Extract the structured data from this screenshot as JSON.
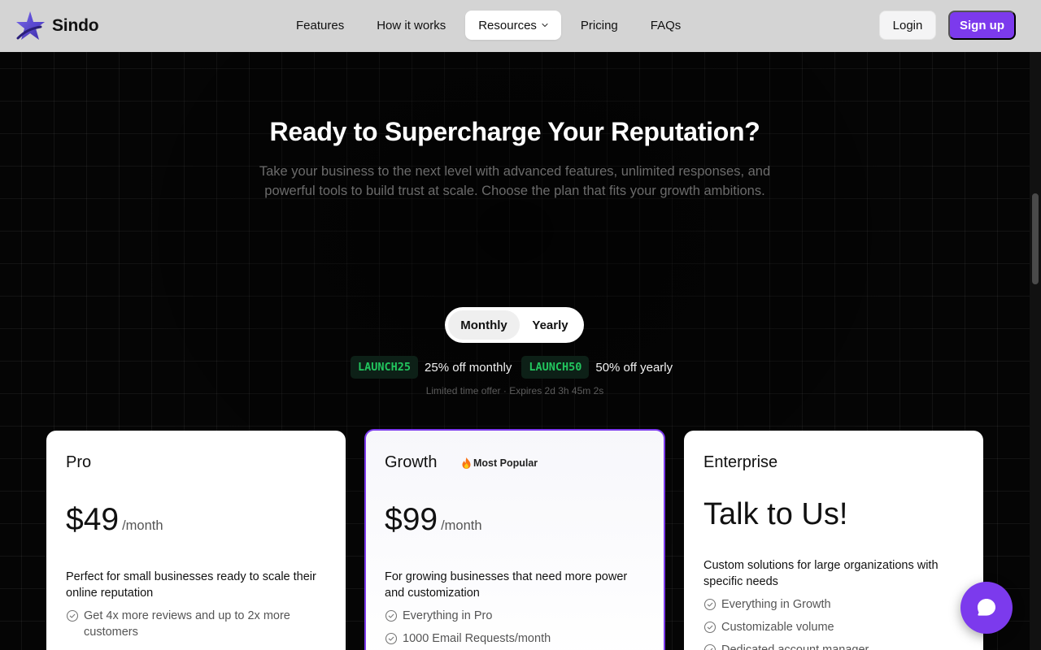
{
  "brand": {
    "name": "Sindo"
  },
  "nav": {
    "items": [
      {
        "label": "Features"
      },
      {
        "label": "How it works"
      },
      {
        "label": "Resources",
        "active": true,
        "has_dropdown": true
      },
      {
        "label": "Pricing"
      },
      {
        "label": "FAQs"
      }
    ]
  },
  "auth": {
    "login_label": "Login",
    "signup_label": "Sign up"
  },
  "hero": {
    "title": "Ready to Supercharge Your Reputation?",
    "subtitle": "Take your business to the next level with advanced features, unlimited responses, and powerful tools to build trust at scale. Choose the plan that fits your growth ambitions."
  },
  "billing_toggle": {
    "options": [
      "Monthly",
      "Yearly"
    ],
    "selected": "Monthly"
  },
  "promos": [
    {
      "code": "LAUNCH25",
      "text": "25% off monthly"
    },
    {
      "code": "LAUNCH50",
      "text": "50% off yearly"
    }
  ],
  "offer_note": "Limited time offer · Expires 2d 3h 45m 2s",
  "plans": {
    "pro": {
      "name": "Pro",
      "price": "$49",
      "period": "/month",
      "description": "Perfect for small businesses ready to scale their online reputation",
      "features": [
        "Get 4x more reviews and up to 2x more customers"
      ]
    },
    "growth": {
      "name": "Growth",
      "badge": "Most Popular",
      "price": "$99",
      "period": "/month",
      "description": "For growing businesses that need more power and customization",
      "features": [
        "Everything in Pro",
        "1000 Email Requests/month"
      ]
    },
    "enterprise": {
      "name": "Enterprise",
      "headline": "Talk to Us!",
      "description": "Custom solutions for large organizations with specific needs",
      "features": [
        "Everything in Growth",
        "Customizable volume",
        "Dedicated account manager"
      ]
    }
  },
  "colors": {
    "accent": "#7c3aed",
    "promo_code_text": "#22c55e",
    "header_bg": "#d4d4d4",
    "page_bg": "#050505"
  },
  "icons": {
    "brand": "star-logo-icon",
    "dropdown": "chevron-down-icon",
    "feature_check": "check-circle-icon",
    "badge": "fire-icon",
    "chat": "chat-bubble-icon"
  }
}
